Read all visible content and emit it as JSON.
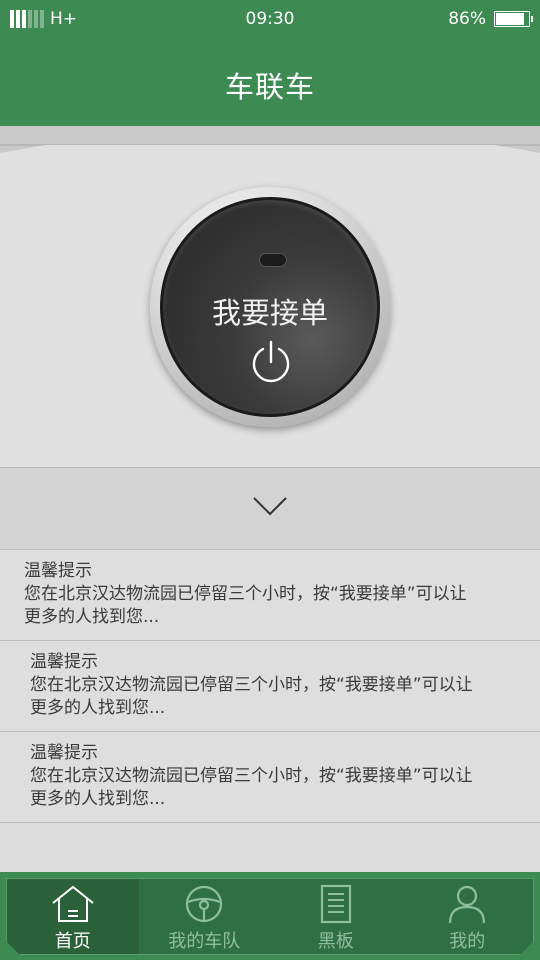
{
  "status_bar": {
    "network": "H+",
    "time": "09:30",
    "battery": "86%",
    "battery_level": 0.86
  },
  "header": {
    "title": "车联车"
  },
  "power_button": {
    "label": "我要接单"
  },
  "notices": [
    {
      "title": "温馨提示",
      "body_line1": "您在北京汉达物流园已停留三个小时，按“我要接单”可以让",
      "body_line2": "更多的人找到您..."
    },
    {
      "title": "温馨提示",
      "body_line1": "您在北京汉达物流园已停留三个小时，按“我要接单”可以让",
      "body_line2": "更多的人找到您..."
    },
    {
      "title": "温馨提示",
      "body_line1": "您在北京汉达物流园已停留三个小时，按“我要接单”可以让",
      "body_line2": "更多的人找到您..."
    }
  ],
  "tabs": [
    {
      "label": "首页",
      "icon": "home-icon",
      "active": true
    },
    {
      "label": "我的车队",
      "icon": "steering-wheel-icon",
      "active": false
    },
    {
      "label": "黑板",
      "icon": "document-icon",
      "active": false
    },
    {
      "label": "我的",
      "icon": "user-icon",
      "active": false
    }
  ],
  "colors": {
    "brand_green": "#3d8a52",
    "tab_bar_green": "#2f7042"
  }
}
